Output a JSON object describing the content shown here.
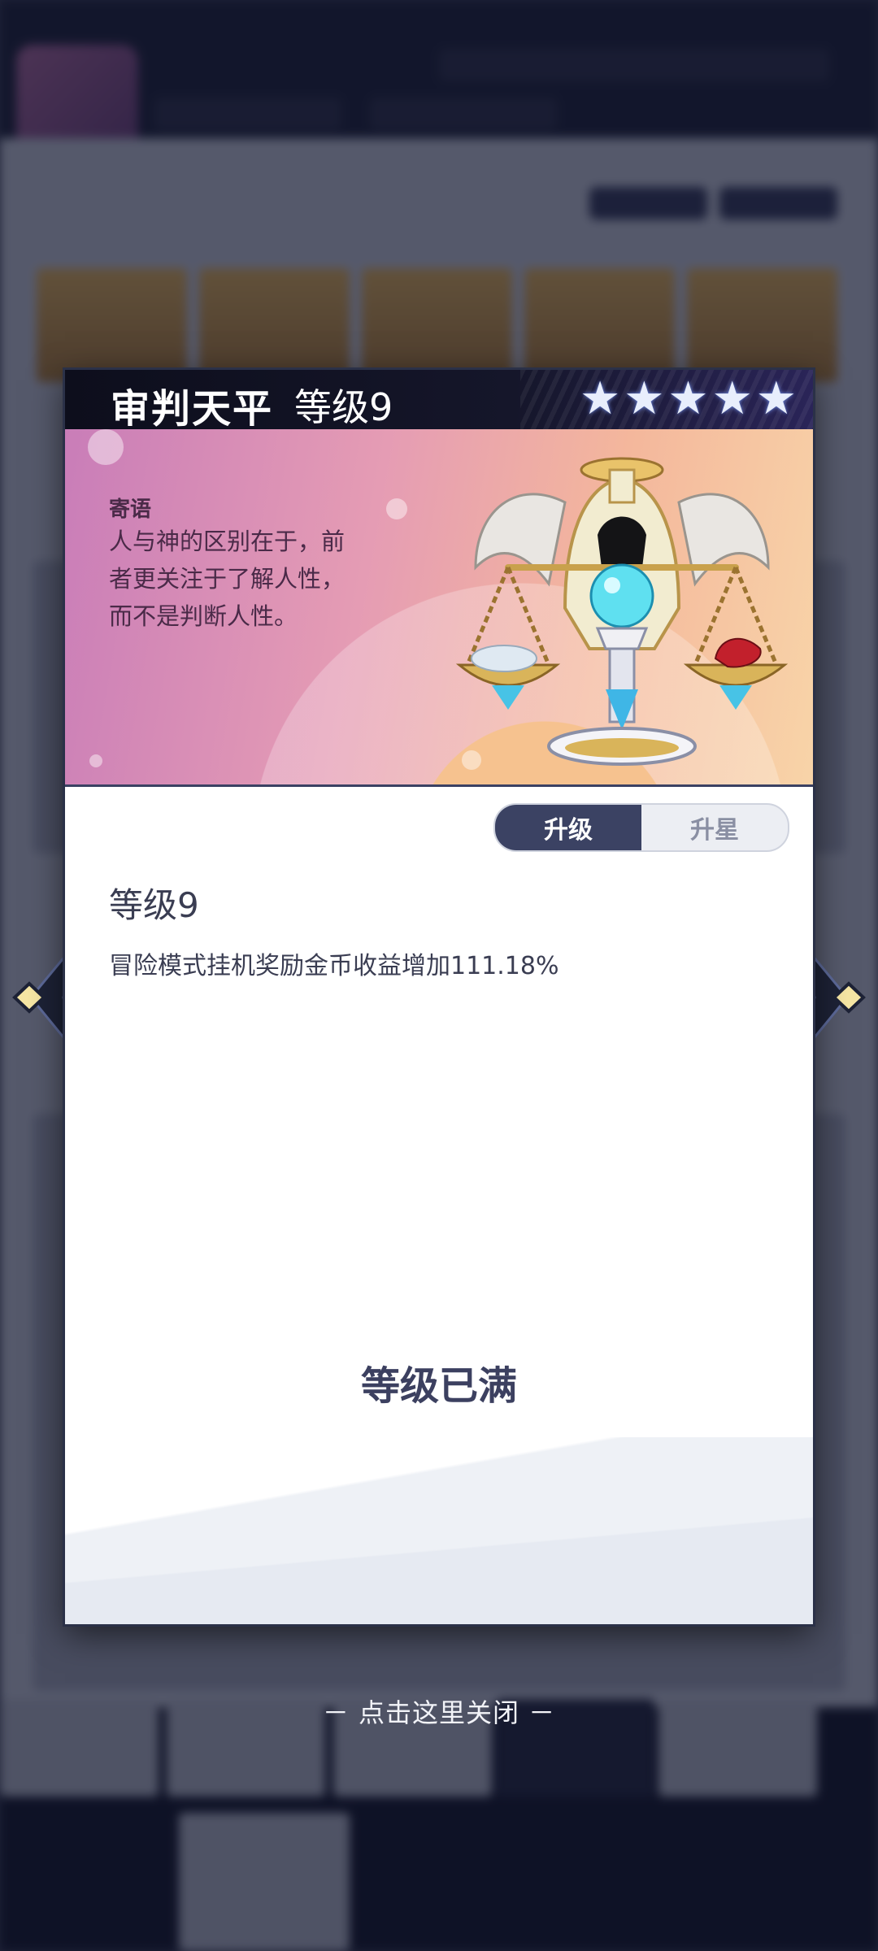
{
  "relic": {
    "name": "审判天平",
    "level_label": "等级9",
    "stars": 5,
    "motto_title": "寄语",
    "motto_lines": [
      "人与神的区别在于，前",
      "者更关注于了解人性，",
      "而不是判断人性。"
    ]
  },
  "tabs": [
    {
      "label": "升级",
      "active": true
    },
    {
      "label": "升星",
      "active": false
    }
  ],
  "detail": {
    "level_heading": "等级9",
    "effect": "冒险模式挂机奖励金币收益增加111.18%",
    "max_label": "等级已满"
  },
  "close_hint": "－ 点击这里关闭 －",
  "colors": {
    "header_bg": "#15162a",
    "tab_active": "#3b4263",
    "text_dark": "#3a3d52",
    "overlay": "#0e1226"
  }
}
